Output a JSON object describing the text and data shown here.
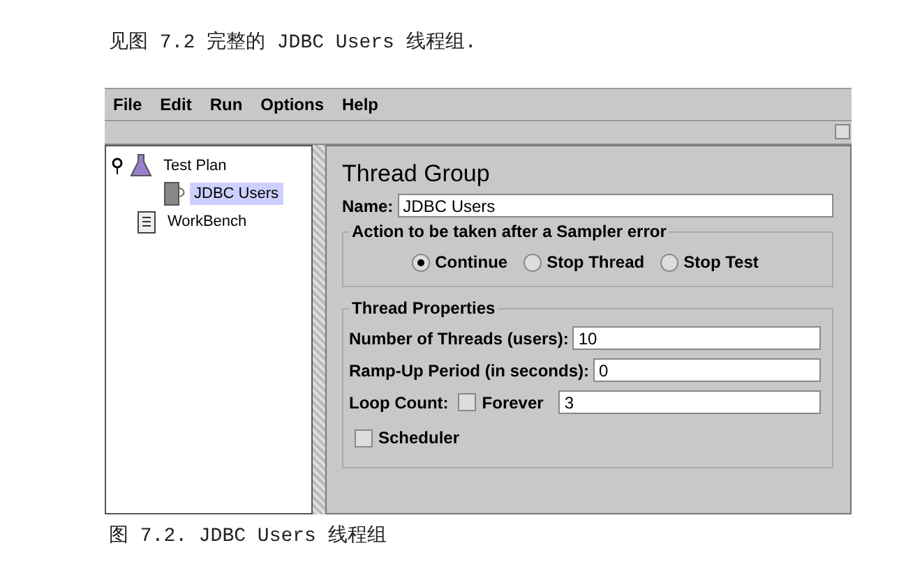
{
  "caption_top": "见图 7.2 完整的 JDBC Users 线程组.",
  "menu": [
    "File",
    "Edit",
    "Run",
    "Options",
    "Help"
  ],
  "tree": [
    {
      "label": "Test Plan",
      "kind": "plan",
      "expanded": true,
      "selected": false,
      "children": [
        {
          "label": "JDBC Users",
          "kind": "threads",
          "selected": true
        }
      ]
    },
    {
      "label": "WorkBench",
      "kind": "bench",
      "selected": false
    }
  ],
  "panel": {
    "title": "Thread Group",
    "name_label": "Name:",
    "name_value": "JDBC Users",
    "error_group": {
      "legend": "Action to be taken after a Sampler error",
      "options": [
        {
          "label": "Continue",
          "selected": true
        },
        {
          "label": "Stop Thread",
          "selected": false
        },
        {
          "label": "Stop Test",
          "selected": false
        }
      ]
    },
    "properties": {
      "legend": "Thread Properties",
      "threads_label": "Number of Threads (users):",
      "threads_value": "10",
      "rampup_label": "Ramp-Up Period (in seconds):",
      "rampup_value": "0",
      "loop_label": "Loop Count:",
      "forever": {
        "label": "Forever",
        "checked": false
      },
      "loop_value": "3"
    },
    "scheduler": {
      "label": "Scheduler",
      "checked": false
    }
  },
  "caption_bottom": "图 7.2. JDBC Users 线程组"
}
